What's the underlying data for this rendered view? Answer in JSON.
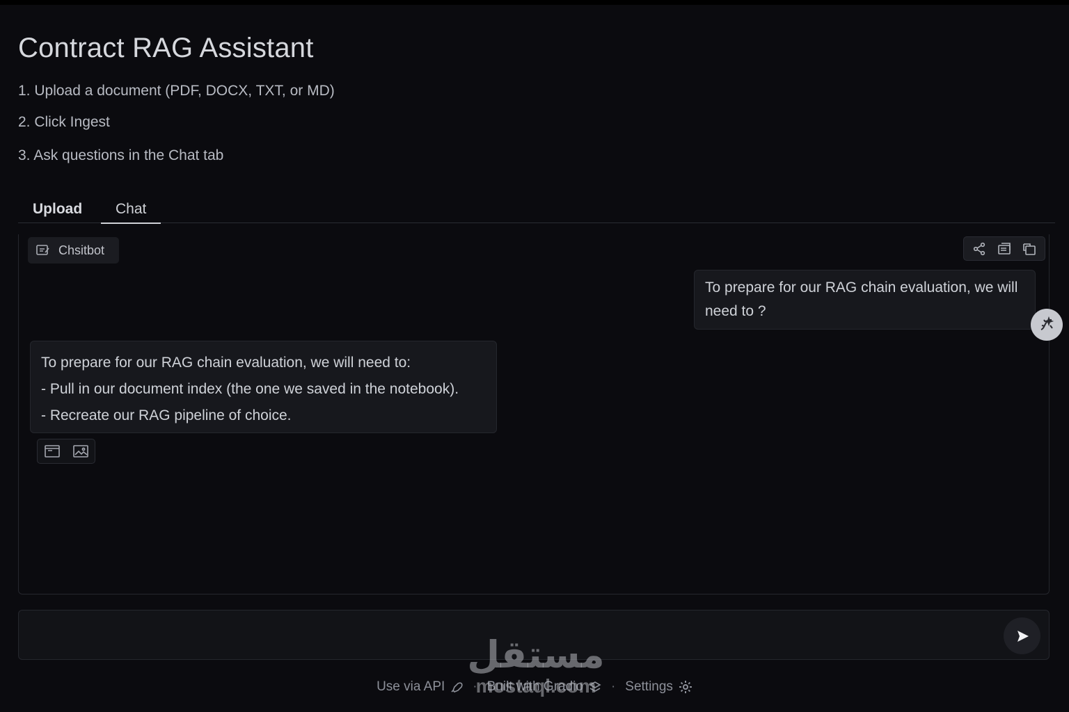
{
  "app": {
    "title": "Contract RAG Assistant",
    "steps": [
      "1. Upload a document (PDF, DOCX, TXT, or MD)",
      "2. Click Ingest",
      "3. Ask questions in the Chat tab"
    ]
  },
  "tabs": [
    {
      "label": "Upload",
      "active": false
    },
    {
      "label": "Chat",
      "active": true
    }
  ],
  "chatbot": {
    "label": "Chsitbot",
    "label_icon": "chatbot-icon",
    "tools": [
      "share-icon",
      "copy-all-icon",
      "clear-icon"
    ],
    "messages": [
      {
        "role": "user",
        "text": "To prepare for our RAG chain evaluation, we will need to ?"
      },
      {
        "role": "assistant",
        "lines": [
          "To prepare for our RAG chain evaluation, we will need to:",
          "- Pull in our document index (the one we saved in the notebook).",
          "- Recreate our RAG pipeline of choice."
        ]
      }
    ],
    "message_actions": [
      "copy-icon",
      "image-icon"
    ]
  },
  "input": {
    "value": "",
    "placeholder": ""
  },
  "footer": {
    "api_label": "Use via API",
    "built_label": "Built with Gradio",
    "settings_label": "Settings"
  },
  "watermark": {
    "arabic": "مستقل",
    "latin": "mostaql.com"
  },
  "colors": {
    "background": "#0b0b0f",
    "panel": "#17181d",
    "border": "#25272d",
    "text": "#cfd2d8"
  }
}
